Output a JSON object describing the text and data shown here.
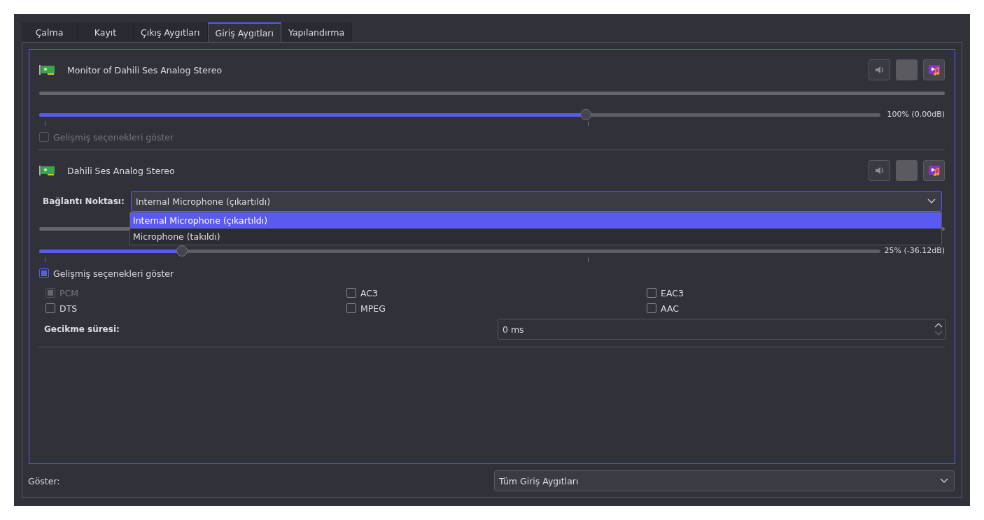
{
  "tabs": [
    {
      "label": "Çalma",
      "selected": false
    },
    {
      "label": "Kayıt",
      "selected": false
    },
    {
      "label": "Çıkış Aygıtları",
      "selected": false
    },
    {
      "label": "Giriş Aygıtları",
      "selected": true
    },
    {
      "label": "Yapılandırma",
      "selected": false
    }
  ],
  "devices": [
    {
      "name": "Monitor of Dahili Ses Analog Stereo",
      "volume": {
        "level": 0.65
      },
      "reading": "100% (0.00dB)",
      "advanced": {
        "label": "Gelişmiş seçenekleri göster",
        "checked": false,
        "disabled": true
      }
    },
    {
      "name": "Dahili Ses Analog Stereo",
      "port": {
        "label": "Bağlantı Noktası:",
        "value": "Internal Microphone (çıkartıldı)",
        "options": [
          {
            "label": "Internal Microphone (çıkartıldı)",
            "selected": true
          },
          {
            "label": "Microphone (takıldı)",
            "selected": false
          }
        ]
      },
      "volume": {
        "level": 0.17
      },
      "reading": "25% (-36.12dB)",
      "advanced": {
        "label": "Gelişmiş seçenekleri göster",
        "checked": true,
        "disabled": false
      },
      "formats": [
        {
          "label": "PCM",
          "checked": true,
          "disabled": true
        },
        {
          "label": "AC3",
          "checked": false,
          "disabled": false
        },
        {
          "label": "EAC3",
          "checked": false,
          "disabled": false
        },
        {
          "label": "DTS",
          "checked": false,
          "disabled": false
        },
        {
          "label": "MPEG",
          "checked": false,
          "disabled": false
        },
        {
          "label": "AAC",
          "checked": false,
          "disabled": false
        }
      ],
      "latency": {
        "label": "Gecikme süresi:",
        "value": "0 ms"
      }
    }
  ],
  "footer": {
    "label": "Göster:",
    "value": "Tüm Giriş Aygıtları"
  }
}
